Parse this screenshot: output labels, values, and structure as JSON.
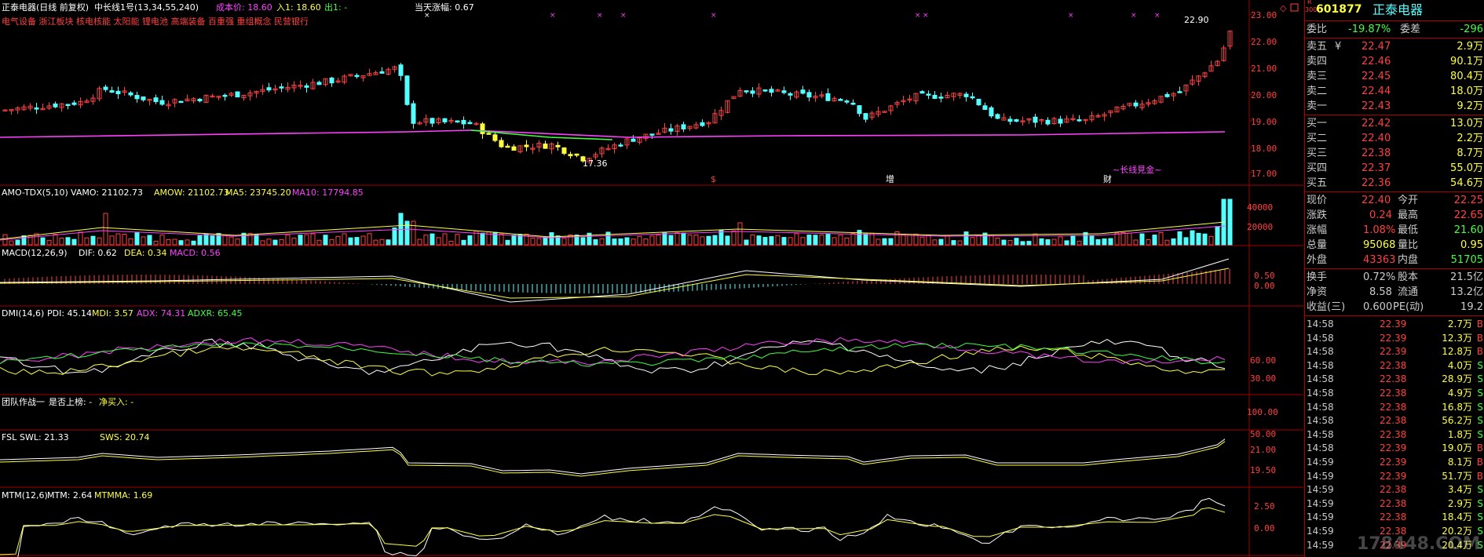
{
  "header": {
    "stock_title": "正泰电器(日线 前复权)",
    "indicator_name": "中长线1号(13,34,55,240)",
    "cost_label": "成本价: 18.60",
    "entry_label": "入1: 18.60",
    "exit_label": "出1: -",
    "amplitude_label": "当天涨幅: 0.67",
    "concepts": "电气设备 浙江板块 核电核能 太阳能 锂电池 高端装备 百重强 重组概念 民营银行"
  },
  "price_panel": {
    "high_label": "22.90",
    "low_label": "17.36",
    "y_ticks": [
      "23.00",
      "22.00",
      "21.00",
      "20.00",
      "19.00",
      "18.00",
      "17.00"
    ],
    "signals": [
      {
        "text": "$",
        "color": "#ff4040"
      },
      {
        "text": "增",
        "color": "#ffffff"
      },
      {
        "text": "财",
        "color": "#ffffff"
      },
      {
        "text": "~长线見金~",
        "color": "#ff40ff"
      }
    ]
  },
  "vol_panel": {
    "title": "AMO-TDX(5,10)",
    "vamo": "VAMO: 21102.73",
    "amow": "AMOW: 21102.73",
    "ma5": "MA5: 23745.20",
    "ma10": "MA10: 17794.85",
    "y_ticks": [
      "40000",
      "20000"
    ]
  },
  "macd_panel": {
    "title": "MACD(12,26,9)",
    "dif": "DIF: 0.62",
    "dea": "DEA: 0.34",
    "macd": "MACD: 0.56",
    "y_ticks": [
      "0.50",
      "0.00"
    ]
  },
  "dmi_panel": {
    "title": "DMI(14,6)",
    "pdi": "PDI: 45.14",
    "mdi": "MDI: 3.57",
    "adx": "ADX: 74.31",
    "adxr": "ADXR: 65.45",
    "y_ticks": [
      "60.00",
      "30.00"
    ]
  },
  "team_panel": {
    "title": "团队作战一",
    "field1": "是否上榜: -",
    "field2": "净买入: -",
    "y_ticks": [
      "100.00",
      "50.00"
    ]
  },
  "fsl_panel": {
    "title": "FSL",
    "swl": "SWL: 21.33",
    "sws": "SWS: 20.74",
    "y_ticks": [
      "21.00",
      "19.50"
    ]
  },
  "mtm_panel": {
    "title": "MTM(12,6)",
    "mtm": "MTM: 2.64",
    "mtmma": "MTMMA: 1.69",
    "y_ticks": [
      "2.50",
      "0.00"
    ]
  },
  "quote": {
    "badge_top": "R",
    "badge_bottom": "300",
    "code": "601877",
    "name": "正泰电器",
    "ratio_label": "委比",
    "ratio_value": "-19.87%",
    "diff_label": "委差",
    "diff_value": "-296",
    "asks": [
      {
        "label": "卖五",
        "price": "22.47",
        "vol": "2.9万"
      },
      {
        "label": "卖四",
        "price": "22.46",
        "vol": "90.1万"
      },
      {
        "label": "卖三",
        "price": "22.45",
        "vol": "80.4万"
      },
      {
        "label": "卖二",
        "price": "22.44",
        "vol": "18.0万"
      },
      {
        "label": "卖一",
        "price": "22.43",
        "vol": "9.2万"
      }
    ],
    "bids": [
      {
        "label": "买一",
        "price": "22.42",
        "vol": "13.0万"
      },
      {
        "label": "买二",
        "price": "22.40",
        "vol": "2.2万"
      },
      {
        "label": "买三",
        "price": "22.38",
        "vol": "8.7万"
      },
      {
        "label": "买四",
        "price": "22.37",
        "vol": "55.0万"
      },
      {
        "label": "买五",
        "price": "22.36",
        "vol": "54.6万"
      }
    ],
    "ask5_mark": "¥",
    "stats": [
      {
        "l1": "现价",
        "v1": "22.40",
        "c1": "#ff4040",
        "l2": "今开",
        "v2": "22.25",
        "c2": "#ff4040"
      },
      {
        "l1": "涨跌",
        "v1": "0.24",
        "c1": "#ff4040",
        "l2": "最高",
        "v2": "22.65",
        "c2": "#ff4040"
      },
      {
        "l1": "涨幅",
        "v1": "1.08%",
        "c1": "#ff4040",
        "l2": "最低",
        "v2": "21.60",
        "c2": "#40ff40"
      },
      {
        "l1": "总量",
        "v1": "95068",
        "c1": "#ffff40",
        "l2": "量比",
        "v2": "0.95",
        "c2": "#ffff40"
      },
      {
        "l1": "外盘",
        "v1": "43363",
        "c1": "#ff4040",
        "l2": "内盘",
        "v2": "51705",
        "c2": "#40ff40"
      }
    ],
    "stats2": [
      {
        "l1": "换手",
        "v1": "0.72%",
        "l2": "股本",
        "v2": "21.5亿"
      },
      {
        "l1": "净资",
        "v1": "8.58",
        "l2": "流通",
        "v2": "13.2亿"
      },
      {
        "l1": "收益(三)",
        "v1": "0.600",
        "l2": "PE(动)",
        "v2": "19.2"
      }
    ]
  },
  "ticks": [
    {
      "time": "14:58",
      "price": "22.39",
      "vol": "2.7万",
      "bs": "B"
    },
    {
      "time": "14:58",
      "price": "22.39",
      "vol": "12.3万",
      "bs": "B"
    },
    {
      "time": "14:58",
      "price": "22.39",
      "vol": "12.8万",
      "bs": "B"
    },
    {
      "time": "14:58",
      "price": "22.38",
      "vol": "4.0万",
      "bs": "S"
    },
    {
      "time": "14:58",
      "price": "22.38",
      "vol": "28.9万",
      "bs": "S"
    },
    {
      "time": "14:58",
      "price": "22.38",
      "vol": "4.9万",
      "bs": "S"
    },
    {
      "time": "14:58",
      "price": "22.38",
      "vol": "16.8万",
      "bs": "S"
    },
    {
      "time": "14:58",
      "price": "22.38",
      "vol": "56.2万",
      "bs": "S"
    },
    {
      "time": "14:58",
      "price": "22.38",
      "vol": "1.8万",
      "bs": "S"
    },
    {
      "time": "14:58",
      "price": "22.39",
      "vol": "19.0万",
      "bs": "B"
    },
    {
      "time": "14:59",
      "price": "22.39",
      "vol": "8.1万",
      "bs": "B"
    },
    {
      "time": "14:59",
      "price": "22.39",
      "vol": "51.7万",
      "bs": "B"
    },
    {
      "time": "14:59",
      "price": "22.38",
      "vol": "3.4万",
      "bs": "S"
    },
    {
      "time": "14:59",
      "price": "22.38",
      "vol": "2.9万",
      "bs": "S"
    },
    {
      "time": "14:59",
      "price": "22.38",
      "vol": "18.4万",
      "bs": "S"
    },
    {
      "time": "14:59",
      "price": "22.38",
      "vol": "20.2万",
      "bs": "S"
    },
    {
      "time": "14:59",
      "price": "22.39",
      "vol": "20.4万",
      "bs": "S"
    }
  ],
  "watermark": "178448.COM",
  "colors": {
    "up": "#ff4040",
    "down": "#54ffff",
    "grid": "#a00000",
    "yellow": "#ffff40",
    "magenta": "#ff40ff",
    "green": "#40ff40"
  }
}
